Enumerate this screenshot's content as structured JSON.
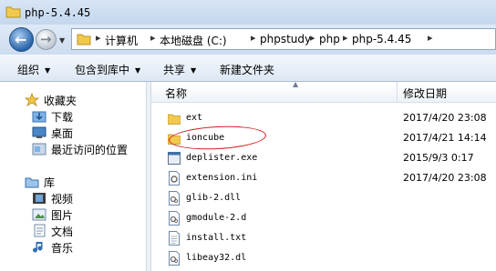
{
  "window": {
    "title": "php-5.4.45"
  },
  "address": {
    "crumbs": [
      "计算机",
      "本地磁盘 (C:)",
      "phpstudy",
      "php",
      "php-5.4.45"
    ]
  },
  "toolbar": {
    "organize": "组织",
    "include_in_library": "包含到库中",
    "share": "共享",
    "new_folder": "新建文件夹"
  },
  "nav": {
    "favorites": {
      "label": "收藏夹",
      "items": [
        "下载",
        "桌面",
        "最近访问的位置"
      ]
    },
    "libraries": {
      "label": "库",
      "items": [
        "视频",
        "图片",
        "文档",
        "音乐"
      ]
    }
  },
  "columns": {
    "name": "名称",
    "date": "修改日期"
  },
  "files": [
    {
      "name": "ext",
      "date": "2017/4/20 23:08",
      "type": "folder"
    },
    {
      "name": "ioncube",
      "date": "2017/4/21 14:14",
      "type": "folder"
    },
    {
      "name": "deplister.exe",
      "date": "2015/9/3 0:17",
      "type": "exe"
    },
    {
      "name": "extension.ini",
      "date": "2017/4/20 23:08",
      "type": "ini"
    },
    {
      "name": "glib-2.dll",
      "date": "",
      "type": "dll"
    },
    {
      "name": "gmodule-2.d",
      "date": "",
      "type": "dll"
    },
    {
      "name": "install.txt",
      "date": "",
      "type": "txt"
    },
    {
      "name": "libeay32.dl",
      "date": "",
      "type": "dll"
    }
  ],
  "colors": {
    "annotation": "#d41f1f",
    "folder": "#f2c94c"
  }
}
